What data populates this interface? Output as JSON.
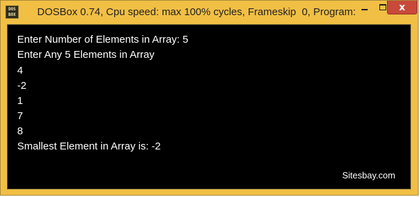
{
  "window": {
    "title": "DOSBox 0.74, Cpu speed: max 100% cycles, Frameskip  0, Program:",
    "icon_name": "dosbox-app-icon",
    "icon_text_top": "DOS",
    "icon_text_bottom": "BOX",
    "controls": {
      "minimize_icon": "minimize-icon",
      "maximize_icon": "maximize-icon",
      "close_icon": "close-icon",
      "close_glyph": "x"
    },
    "colors": {
      "frame": "#f1bf44",
      "close_button": "#c74a3a",
      "console_bg": "#000000",
      "console_text": "#ffffff"
    }
  },
  "console": {
    "lines": [
      "Enter Number of Elements in Array: 5",
      "Enter Any 5 Elements in Array",
      "4",
      "-2",
      "1",
      "7",
      "8",
      "Smallest Element in Array is: -2"
    ],
    "watermark": "Sitesbay.com"
  }
}
